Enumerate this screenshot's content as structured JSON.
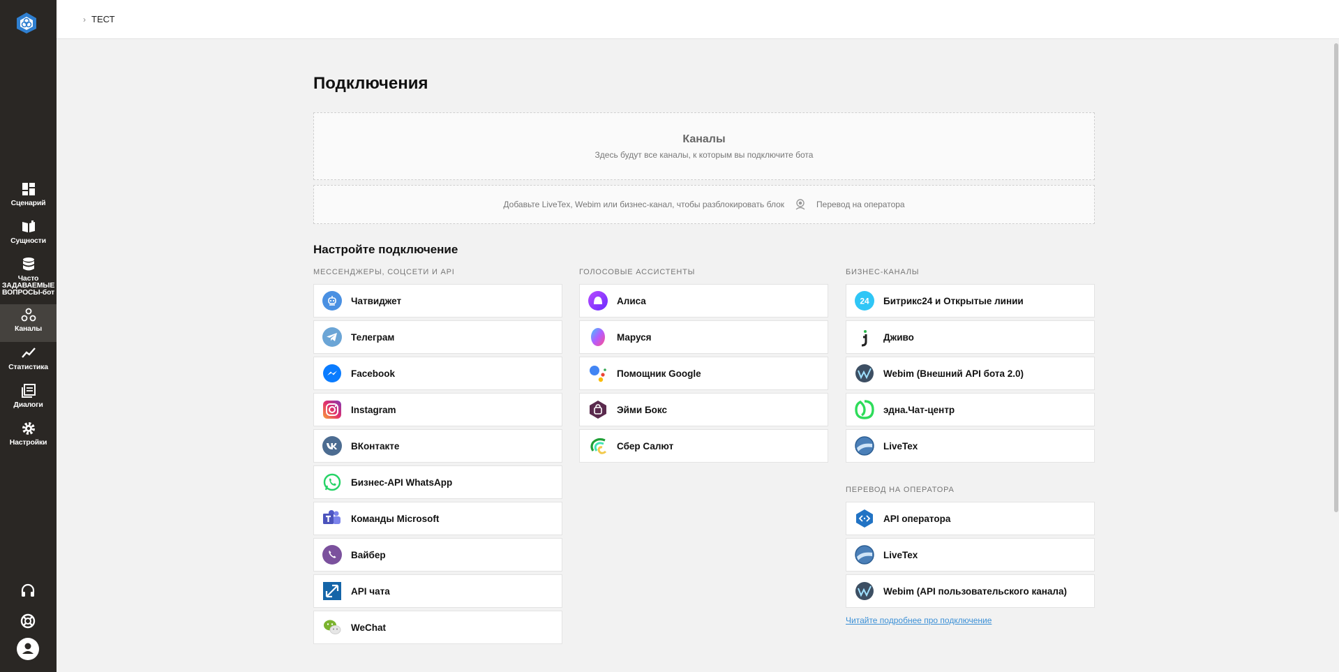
{
  "breadcrumb": {
    "label": "ТЕСТ"
  },
  "nav": [
    {
      "label": "Сценарий",
      "icon": "dashboard-icon"
    },
    {
      "label": "Сущности",
      "icon": "book-icon"
    },
    {
      "label": "Часто ЗАДАВАЕМЫЕ ВОПРОСЫ-бот",
      "icon": "database-icon"
    },
    {
      "label": "Каналы",
      "icon": "channels-icon"
    },
    {
      "label": "Статистика",
      "icon": "chart-icon"
    },
    {
      "label": "Диалоги",
      "icon": "dialogs-icon"
    },
    {
      "label": "Настройки",
      "icon": "gear-icon"
    }
  ],
  "page": {
    "title": "Подключения",
    "channels_title": "Каналы",
    "channels_sub": "Здесь будут все каналы, к которым вы подключите бота",
    "operator_hint": "Добавьте LiveTex, Webim или бизнес-канал, чтобы разблокировать блок",
    "operator_label": "Перевод на оператора",
    "setup_title": "Настройте подключение"
  },
  "messengers": {
    "heading": "МЕССЕНДЖЕРЫ, СОЦСЕТИ И API",
    "items": [
      "Чатвиджет",
      "Телеграм",
      "Facebook",
      "Instagram",
      "ВКонтакте",
      "Бизнес-API WhatsApp",
      "Команды Microsoft",
      "Вайбер",
      "API чата",
      "WeChat"
    ]
  },
  "voice": {
    "heading": "ГОЛОСОВЫЕ АССИСТЕНТЫ",
    "items": [
      "Алиса",
      "Маруся",
      "Помощник Google",
      "Эйми Бокс",
      "Сбер Салют"
    ]
  },
  "business": {
    "heading": "БИЗНЕС-КАНАЛЫ",
    "items": [
      "Битрикс24 и Открытые линии",
      "Дживо",
      "Webim (Внешний API бота 2.0)",
      "эдна.Чат-центр",
      "LiveTex"
    ]
  },
  "operator": {
    "heading": "ПЕРЕВОД НА ОПЕРАТОРА",
    "items": [
      "API оператора",
      "LiveTex",
      "Webim (API пользовательского канала)"
    ],
    "link": "Читайте подробнее про подключение"
  },
  "colors": {
    "sidebar": "#2a2724",
    "sidebar_active": "#45423e",
    "link": "#3a8fd6"
  }
}
